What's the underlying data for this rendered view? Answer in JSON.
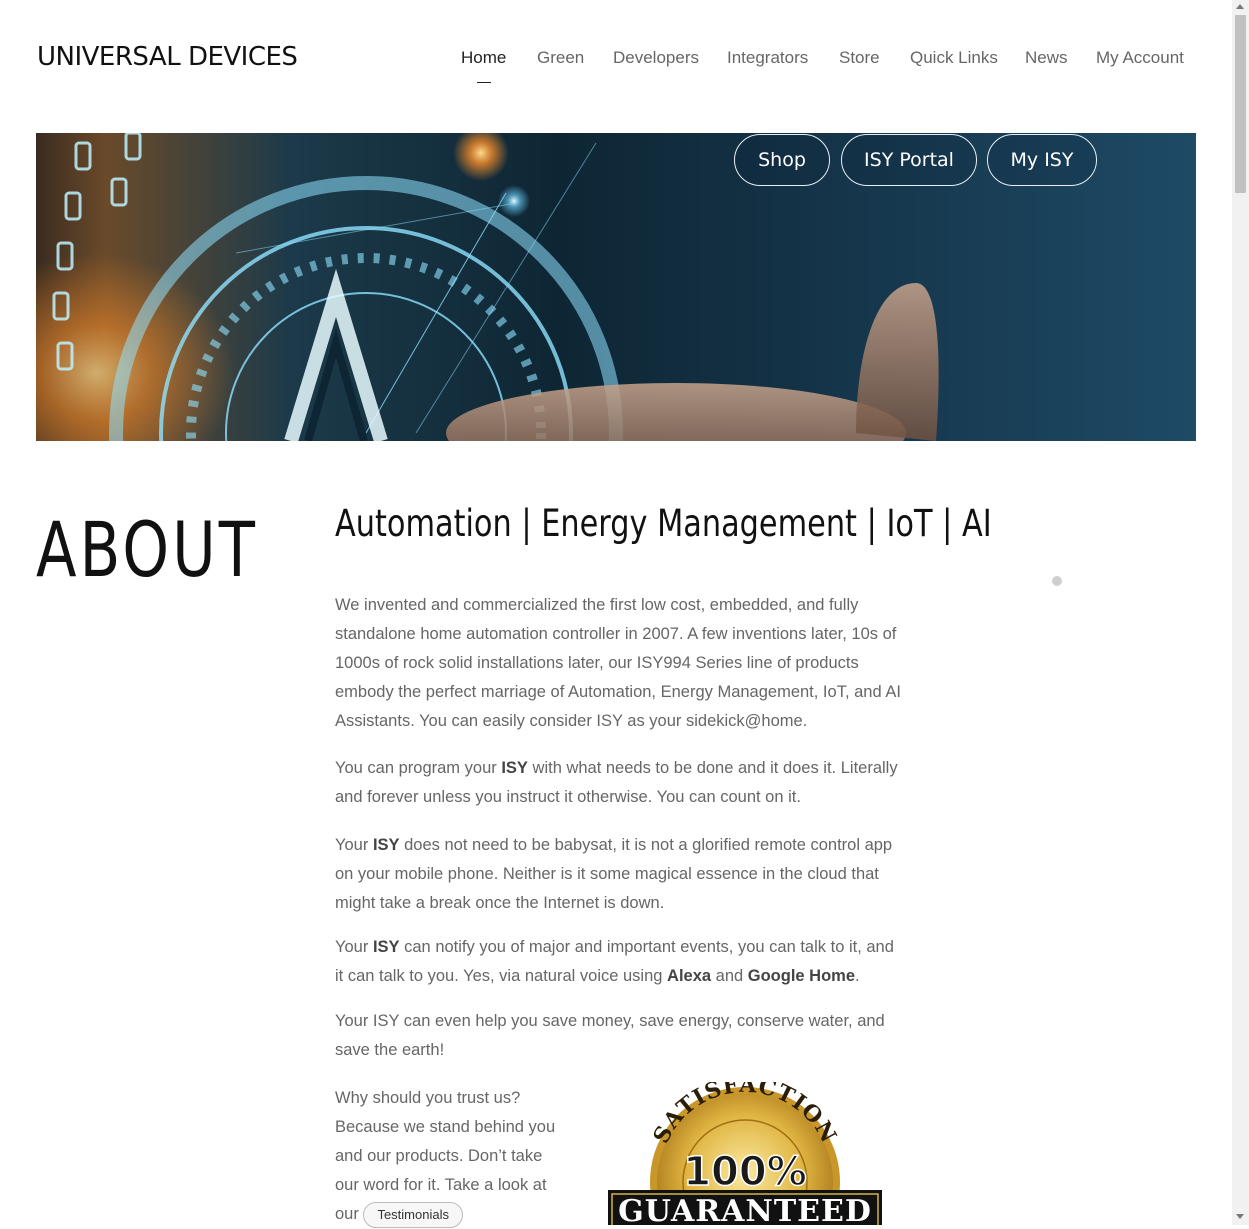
{
  "header": {
    "logo_text": "UNIVERSAL DEVICES",
    "nav": [
      {
        "label": "Home",
        "active": true
      },
      {
        "label": "Green"
      },
      {
        "label": "Developers"
      },
      {
        "label": "Integrators"
      },
      {
        "label": "Store"
      },
      {
        "label": "Quick Links"
      },
      {
        "label": "News"
      },
      {
        "label": "My Account"
      }
    ]
  },
  "hero": {
    "buttons": [
      {
        "label": "Shop"
      },
      {
        "label": "ISY Portal"
      },
      {
        "label": "My ISY"
      }
    ]
  },
  "about": {
    "title": "ABOUT",
    "tagline": "Automation | Energy Management | IoT | AI",
    "p1": "We invented and commercialized the first low cost, embedded, and fully standalone home automation controller in 2007. A few inventions later, 10s of 1000s of rock solid installations later, our ISY994 Series line of products embody the perfect marriage of Automation, Energy Management, IoT, and AI Assistants. You can easily consider ISY as your sidekick@home.",
    "p2": {
      "a": "You can program your ",
      "b": "ISY",
      "c": " with what needs to be done and it does it. Literally and forever unless you instruct it otherwise. You can count on it."
    },
    "p3": {
      "a": "Your ",
      "b": "ISY",
      "c": " does not need to be babysat, it is not a glorified remote control app on your mobile phone. Neither is it some magical essence in the cloud that might take a break once the Internet is down."
    },
    "p4": {
      "a": "Your ",
      "b": "ISY",
      "c": " can notify you of major and important events, you can talk to it, and it can talk to you. Yes, via natural voice using ",
      "d": "Alexa",
      "e": " and ",
      "f": "Google Home",
      "g": "."
    },
    "p5": "Your ISY can even help you save money, save energy, conserve water, and save the earth!",
    "trust_text": "Why should you trust us? Because we stand behind you and our products. Don’t take our word for it. Take a look at our",
    "testimonials_button": "Testimonials",
    "badge": {
      "arc_text": "SATISFACTION",
      "percent": "100%",
      "banner": "GUARANTEED"
    }
  },
  "colors": {
    "accent_gold": "#d4a92f",
    "hero_dark": "#0e2634"
  }
}
